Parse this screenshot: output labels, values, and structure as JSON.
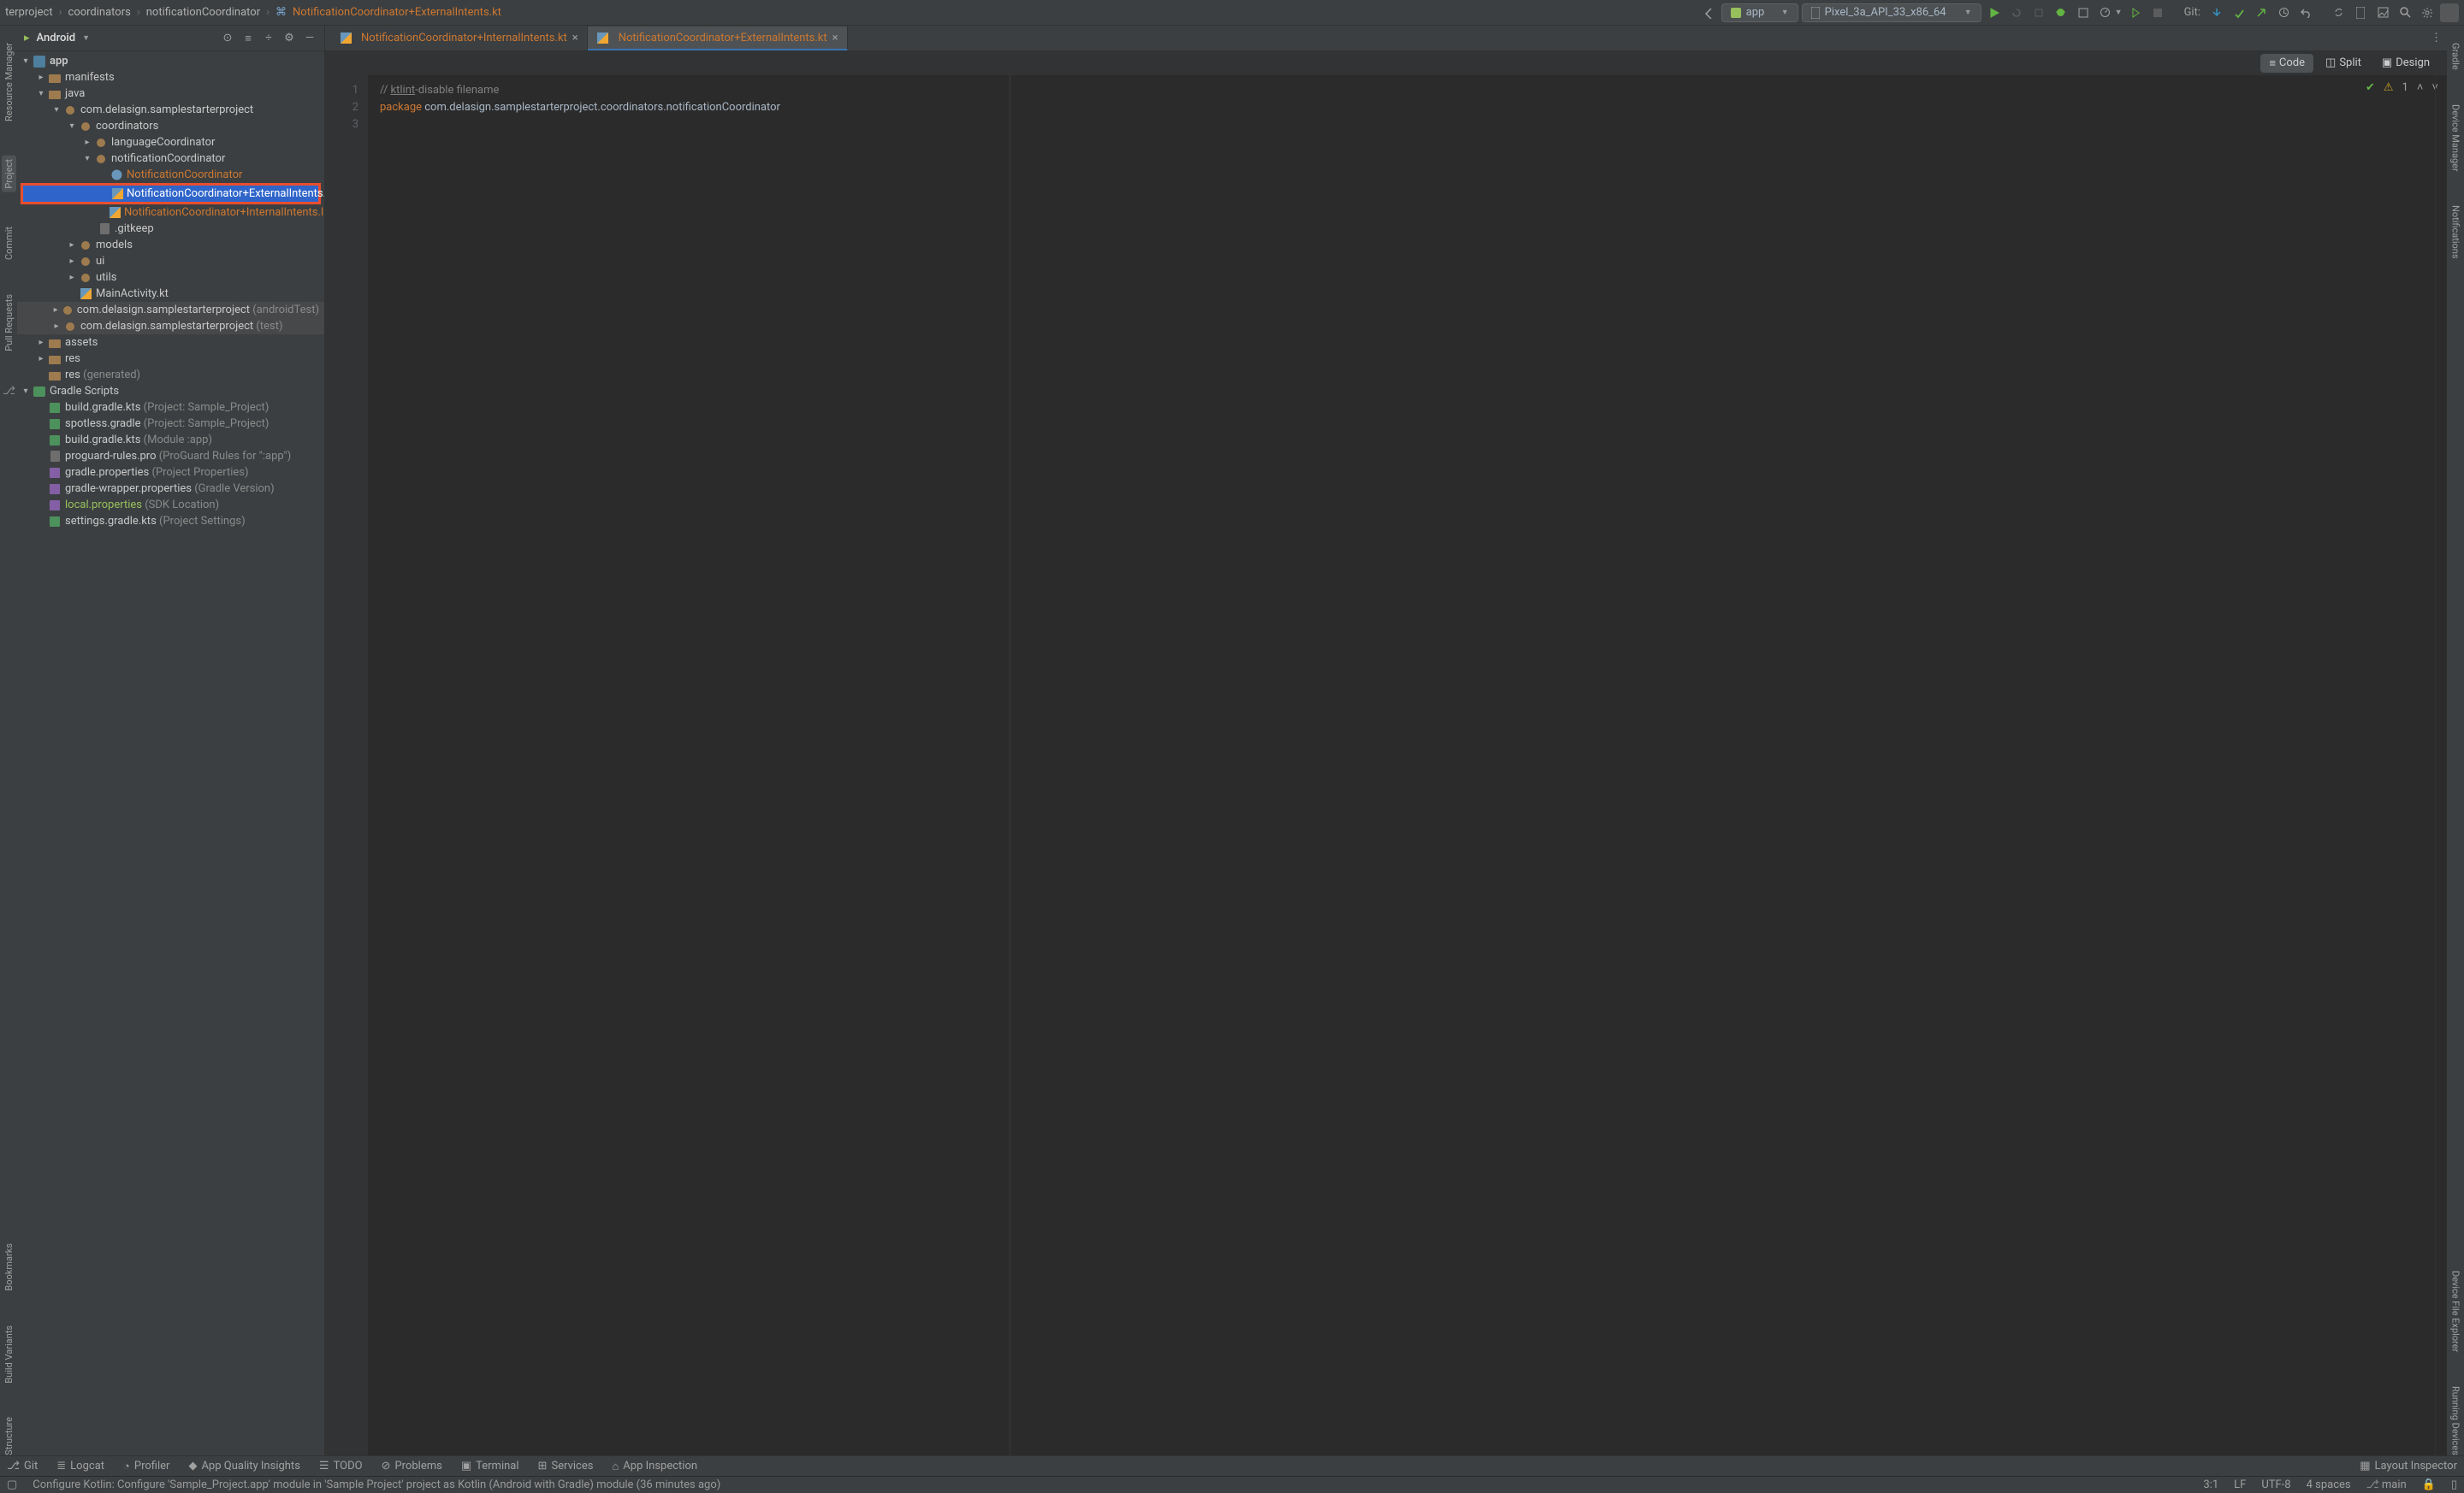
{
  "breadcrumbs": [
    "terproject",
    "coordinators",
    "notificationCoordinator",
    "NotificationCoordinator+ExternalIntents.kt"
  ],
  "run_config": {
    "module": "app",
    "device": "Pixel_3a_API_33_x86_64"
  },
  "git_label": "Git:",
  "tree_header": {
    "title": "Android"
  },
  "tree": {
    "app": "app",
    "manifests": "manifests",
    "java": "java",
    "pkg": "com.delasign.samplestarterproject",
    "coordinators": "coordinators",
    "languageCoordinator": "languageCoordinator",
    "notificationCoordinator": "notificationCoordinator",
    "nc_class": "NotificationCoordinator",
    "nc_ext": "NotificationCoordinator+ExternalIntents.",
    "nc_int": "NotificationCoordinator+InternalIntents.l",
    "gitkeep": ".gitkeep",
    "models": "models",
    "ui": "ui",
    "utils": "utils",
    "main_activity": "MainActivity.kt",
    "pkg_android_test": "com.delasign.samplestarterproject",
    "pkg_android_test_suffix": "(androidTest)",
    "pkg_test": "com.delasign.samplestarterproject",
    "pkg_test_suffix": "(test)",
    "assets": "assets",
    "res": "res",
    "res_gen": "res",
    "res_gen_suffix": "(generated)",
    "gradle_scripts": "Gradle Scripts",
    "build_gradle_proj": "build.gradle.kts",
    "build_gradle_proj_suffix": "(Project: Sample_Project)",
    "spotless": "spotless.gradle",
    "spotless_suffix": "(Project: Sample_Project)",
    "build_gradle_app": "build.gradle.kts",
    "build_gradle_app_suffix": "(Module :app)",
    "proguard": "proguard-rules.pro",
    "proguard_suffix": "(ProGuard Rules for \":app\")",
    "gradle_props": "gradle.properties",
    "gradle_props_suffix": "(Project Properties)",
    "gradle_wrapper": "gradle-wrapper.properties",
    "gradle_wrapper_suffix": "(Gradle Version)",
    "local_props": "local.properties",
    "local_props_suffix": "(SDK Location)",
    "settings": "settings.gradle.kts",
    "settings_suffix": "(Project Settings)"
  },
  "left_strip": [
    "Resource Manager",
    "Project",
    "Commit",
    "Pull Requests",
    "Bookmarks",
    "Build Variants",
    "Structure"
  ],
  "right_strip": [
    "Gradle",
    "Device Manager",
    "Notifications",
    "Device File Explorer",
    "Running Devices"
  ],
  "editor_tabs": [
    {
      "label": "NotificationCoordinator+InternalIntents.kt",
      "active": false
    },
    {
      "label": "NotificationCoordinator+ExternalIntents.kt",
      "active": true
    }
  ],
  "view_switch": {
    "code": "Code",
    "split": "Split",
    "design": "Design"
  },
  "code": {
    "line1a": "// ",
    "line1b": "ktlint",
    "line1c": "-disable filename",
    "line2a": "package",
    "line2b": " com.delasign.samplestarterproject.coordinators.notificationCoordinator"
  },
  "code_warnings": "1",
  "bottom_tools": [
    "Git",
    "Logcat",
    "Profiler",
    "App Quality Insights",
    "TODO",
    "Problems",
    "Terminal",
    "Services",
    "App Inspection"
  ],
  "layout_inspector": "Layout Inspector",
  "status": {
    "msg": "Configure Kotlin: Configure 'Sample_Project.app' module in 'Sample Project' project as Kotlin (Android with Gradle) module (36 minutes ago)",
    "pos": "3:1",
    "le": "LF",
    "enc": "UTF-8",
    "indent": "4 spaces",
    "branch": "main"
  }
}
